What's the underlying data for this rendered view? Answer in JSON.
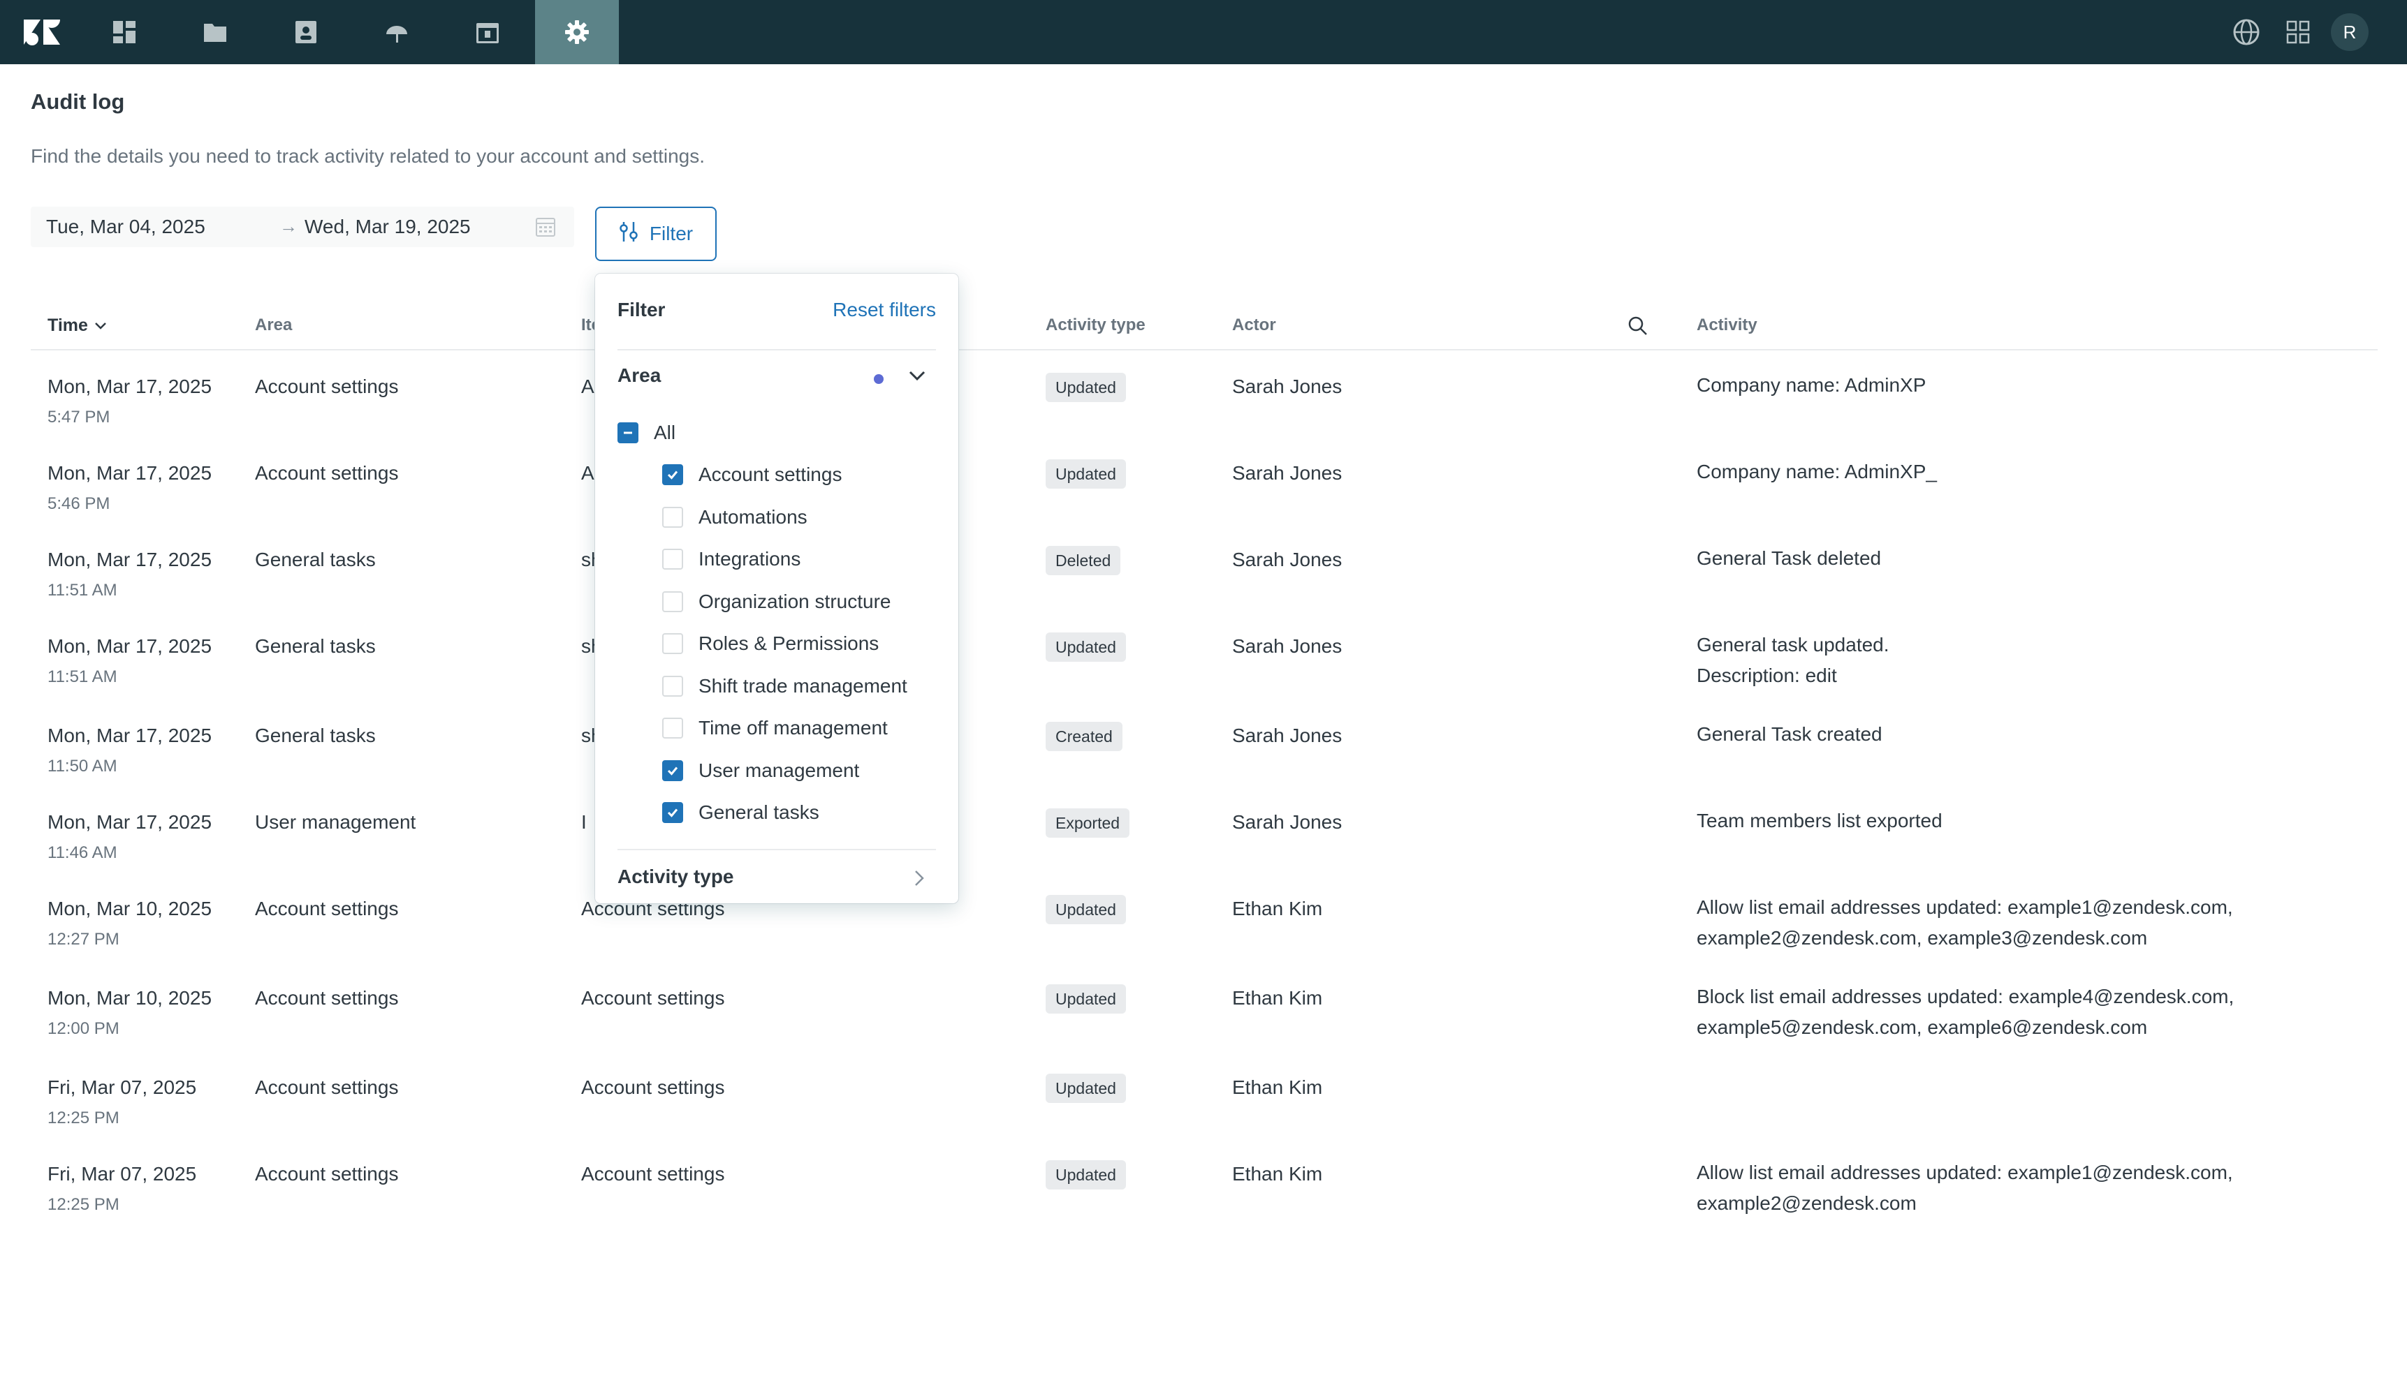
{
  "nav": {
    "items": [
      {
        "name": "zendesk-logo-icon"
      },
      {
        "name": "dashboard-icon"
      },
      {
        "name": "folder-icon"
      },
      {
        "name": "contacts-icon"
      },
      {
        "name": "forecast-icon"
      },
      {
        "name": "calendar-icon"
      },
      {
        "name": "settings-icon",
        "active": true
      }
    ],
    "avatar_initial": "R"
  },
  "page": {
    "title": "Audit log",
    "description": "Find the details you need to track activity related to your account and settings."
  },
  "date_range": {
    "start": "Tue, Mar 04, 2025",
    "arrow": "→",
    "end": "Wed, Mar 19, 2025"
  },
  "filter_button": {
    "label": "Filter"
  },
  "table": {
    "columns": {
      "time": "Time",
      "area": "Area",
      "item": "Ite",
      "activity_type": "Activity type",
      "actor": "Actor",
      "activity": "Activity"
    },
    "rows": [
      {
        "date": "Mon, Mar 17, 2025",
        "time": "5:47 PM",
        "area": "Account settings",
        "item": "Ac",
        "type": "Updated",
        "actor": "Sarah Jones",
        "activity": [
          "Company name: AdminXP"
        ]
      },
      {
        "date": "Mon, Mar 17, 2025",
        "time": "5:46 PM",
        "area": "Account settings",
        "item": "Ac",
        "type": "Updated",
        "actor": "Sarah Jones",
        "activity": [
          "Company name: AdminXP_"
        ]
      },
      {
        "date": "Mon, Mar 17, 2025",
        "time": "11:51 AM",
        "area": "General tasks",
        "item": "sh",
        "type": "Deleted",
        "actor": "Sarah Jones",
        "activity": [
          "General Task deleted"
        ]
      },
      {
        "date": "Mon, Mar 17, 2025",
        "time": "11:51 AM",
        "area": "General tasks",
        "item": "sh",
        "type": "Updated",
        "actor": "Sarah Jones",
        "activity": [
          "General task updated.",
          "Description: edit"
        ]
      },
      {
        "date": "Mon, Mar 17, 2025",
        "time": "11:50 AM",
        "area": "General tasks",
        "item": "sh",
        "type": "Created",
        "actor": "Sarah Jones",
        "activity": [
          "General Task created"
        ]
      },
      {
        "date": "Mon, Mar 17, 2025",
        "time": "11:46 AM",
        "area": "User management",
        "item": "I",
        "type": "Exported",
        "actor": "Sarah Jones",
        "activity": [
          "Team members list exported"
        ]
      },
      {
        "date": "Mon, Mar 10, 2025",
        "time": "12:27 PM",
        "area": "Account settings",
        "item": "Account settings",
        "type": "Updated",
        "actor": "Ethan Kim",
        "activity": [
          "Allow list email addresses updated: example1@zendesk.com,",
          "example2@zendesk.com, example3@zendesk.com"
        ]
      },
      {
        "date": "Mon, Mar 10, 2025",
        "time": "12:00 PM",
        "area": "Account settings",
        "item": "Account settings",
        "type": "Updated",
        "actor": "Ethan Kim",
        "activity": [
          "Block list email addresses updated: example4@zendesk.com,",
          "example5@zendesk.com, example6@zendesk.com"
        ]
      },
      {
        "date": "Fri, Mar 07, 2025",
        "time": "12:25 PM",
        "area": "Account settings",
        "item": "Account settings",
        "type": "Updated",
        "actor": "Ethan Kim",
        "activity": []
      },
      {
        "date": "Fri, Mar 07, 2025",
        "time": "12:25 PM",
        "area": "Account settings",
        "item": "Account settings",
        "type": "Updated",
        "actor": "Ethan Kim",
        "activity": [
          "Allow list email addresses updated: example1@zendesk.com,",
          "example2@zendesk.com"
        ]
      }
    ]
  },
  "filter_popover": {
    "title": "Filter",
    "reset_label": "Reset filters",
    "area_label": "Area",
    "all_label": "All",
    "options": [
      {
        "label": "Account settings",
        "checked": true
      },
      {
        "label": "Automations",
        "checked": false
      },
      {
        "label": "Integrations",
        "checked": false
      },
      {
        "label": "Organization structure",
        "checked": false
      },
      {
        "label": "Roles & Permissions",
        "checked": false
      },
      {
        "label": "Shift trade management",
        "checked": false
      },
      {
        "label": "Time off management",
        "checked": false
      },
      {
        "label": "User management",
        "checked": true
      },
      {
        "label": "General tasks",
        "checked": true
      }
    ],
    "activity_type_label": "Activity type"
  },
  "colors": {
    "topbar": "#17323b",
    "active_nav": "#5c8388",
    "accent": "#1f73b7",
    "area_dot": "#5d6bd4"
  }
}
